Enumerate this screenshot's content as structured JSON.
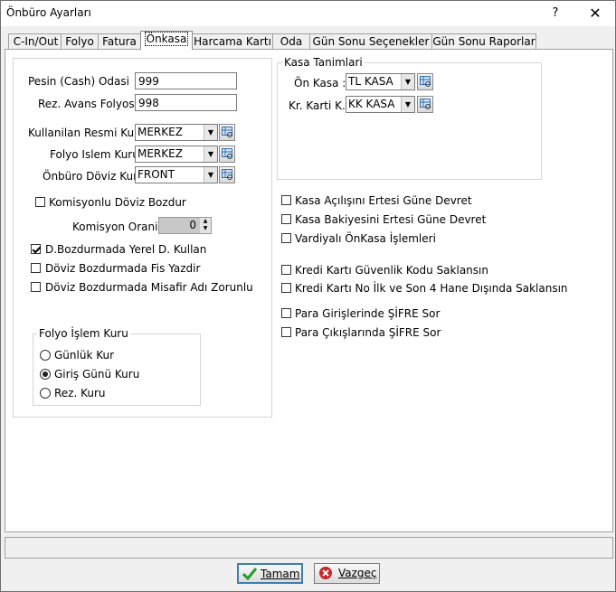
{
  "window": {
    "title": "Önbüro Ayarları",
    "help": "?",
    "close": "✕"
  },
  "tabs": [
    "C-In/Out",
    "Folyo",
    "Fatura",
    "Önkasa",
    "Harcama Kartı",
    "Oda",
    "Gün Sonu Seçenekler",
    "Gün Sonu Raporlar"
  ],
  "active_tab": "Önkasa",
  "left": {
    "pesin_label": "Pesin (Cash) Odasi",
    "pesin_value": "999",
    "rez_label": "Rez. Avans Folyosu",
    "rez_value": "998",
    "resmi_kur_label": "Kullanilan Resmi Kur",
    "resmi_kur_value": "MERKEZ",
    "folyo_kur_label": "Folyo Islem Kuru",
    "folyo_kur_value": "MERKEZ",
    "doviz_kur_label": "Önbüro Döviz Kuru",
    "doviz_kur_value": "FRONT",
    "komisyonlu_label": "Komisyonlu Döviz Bozdur",
    "komisyonlu_checked": false,
    "komisyon_orani_label": "Komisyon Orani",
    "komisyon_orani_value": "0",
    "yerel_label": "D.Bozdurmada Yerel D. Kullan",
    "yerel_checked": true,
    "fis_label": "Döviz Bozdurmada Fis Yazdir",
    "fis_checked": false,
    "misafir_label": "Döviz Bozdurmada Misafir Adı Zorunlu",
    "misafir_checked": false
  },
  "folyo_islem_kuru": {
    "title": "Folyo İşlem Kuru",
    "options": [
      "Günlük Kur",
      "Giriş Günü Kuru",
      "Rez. Kuru"
    ],
    "selected": "Giriş Günü Kuru"
  },
  "kasa": {
    "title": "Kasa Tanimlari",
    "on_kasa_label": "Ön Kasa :",
    "on_kasa_value": "TL KASA",
    "kk_label": "Kr. Karti K.:",
    "kk_value": "KK KASA"
  },
  "right_checks": [
    {
      "label": "Kasa Açılışını Ertesi Güne Devret",
      "checked": false
    },
    {
      "label": "Kasa Bakiyesini Ertesi Güne Devret",
      "checked": false
    },
    {
      "label": "Vardiyalı ÖnKasa İşlemleri",
      "checked": false
    },
    {
      "label": "Kredi Kartı Güvenlik Kodu Saklansın",
      "checked": false
    },
    {
      "label": "Kredi Kartı No İlk ve Son 4 Hane Dışında Saklansın",
      "checked": false
    },
    {
      "label": "Para Girişlerinde ŞİFRE Sor",
      "checked": false
    },
    {
      "label": "Para Çıkışlarında ŞİFRE Sor",
      "checked": false
    }
  ],
  "buttons": {
    "ok": "Tamam",
    "cancel": "Vazgeç"
  },
  "colors": {
    "ok_icon": "#1e9e2a",
    "cancel_icon": "#c62828",
    "default_border": "#3c7fb1"
  }
}
